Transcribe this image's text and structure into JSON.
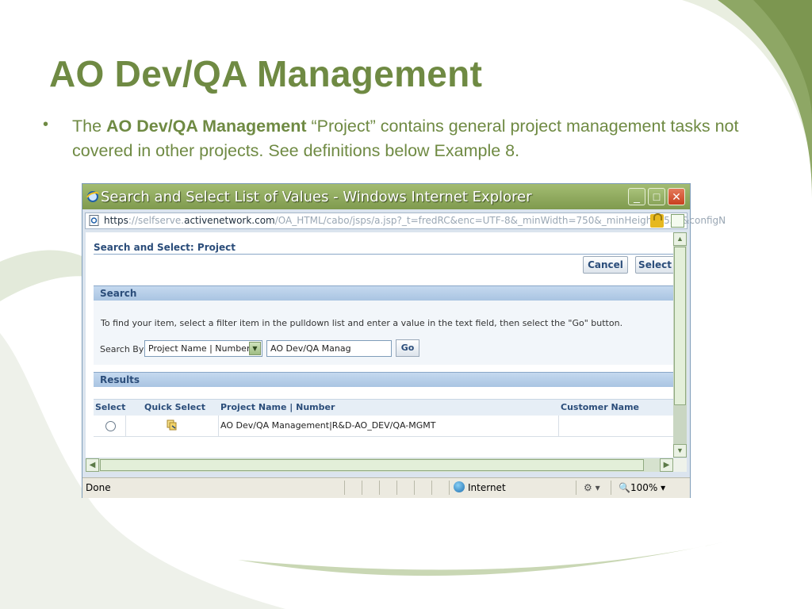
{
  "slide": {
    "title": "AO Dev/QA Management",
    "bullet_marker": "•",
    "bullet_pre": "The ",
    "bullet_bold": "AO Dev/QA Management",
    "bullet_post": " “Project” contains general project management tasks not covered in other projects.  See definitions below Example 8."
  },
  "window": {
    "title": "Search and Select List of Values - Windows Internet Explorer",
    "address_scheme": "https",
    "address_host_pre": "://selfserve.",
    "address_host": "activenetwork.com",
    "address_path": "/OA_HTML/cabo/jsps/a.jsp?_t=fredRC&enc=UTF-8&_minWidth=750&_minHeight=550&configN",
    "controls": {
      "minimize": "_",
      "maximize": "□",
      "close": "✕"
    }
  },
  "page": {
    "heading": "Search and Select: Project",
    "cancel_label": "Cancel",
    "select_label": "Select",
    "search": {
      "section_label": "Search",
      "instructions": "To find your item, select a filter item in the pulldown list and enter a value in the text field, then select the \"Go\" button.",
      "search_by_label": "Search By",
      "filter_value": "Project Name | Number",
      "text_value": "AO Dev/QA Manag",
      "go_label": "Go"
    },
    "results": {
      "section_label": "Results",
      "columns": [
        "Select",
        "Quick Select",
        "Project Name | Number",
        "Customer Name"
      ],
      "rows": [
        {
          "project": "AO Dev/QA Management|R&D-AO_DEV/QA-MGMT",
          "customer": ""
        }
      ]
    }
  },
  "statusbar": {
    "status": "Done",
    "zone": "Internet",
    "security": "▾",
    "zoom": "100%"
  },
  "colors": {
    "slide_green": "#6f8a43",
    "titlebar": "#8fa85e",
    "section_bar": "#b8cfe8"
  }
}
